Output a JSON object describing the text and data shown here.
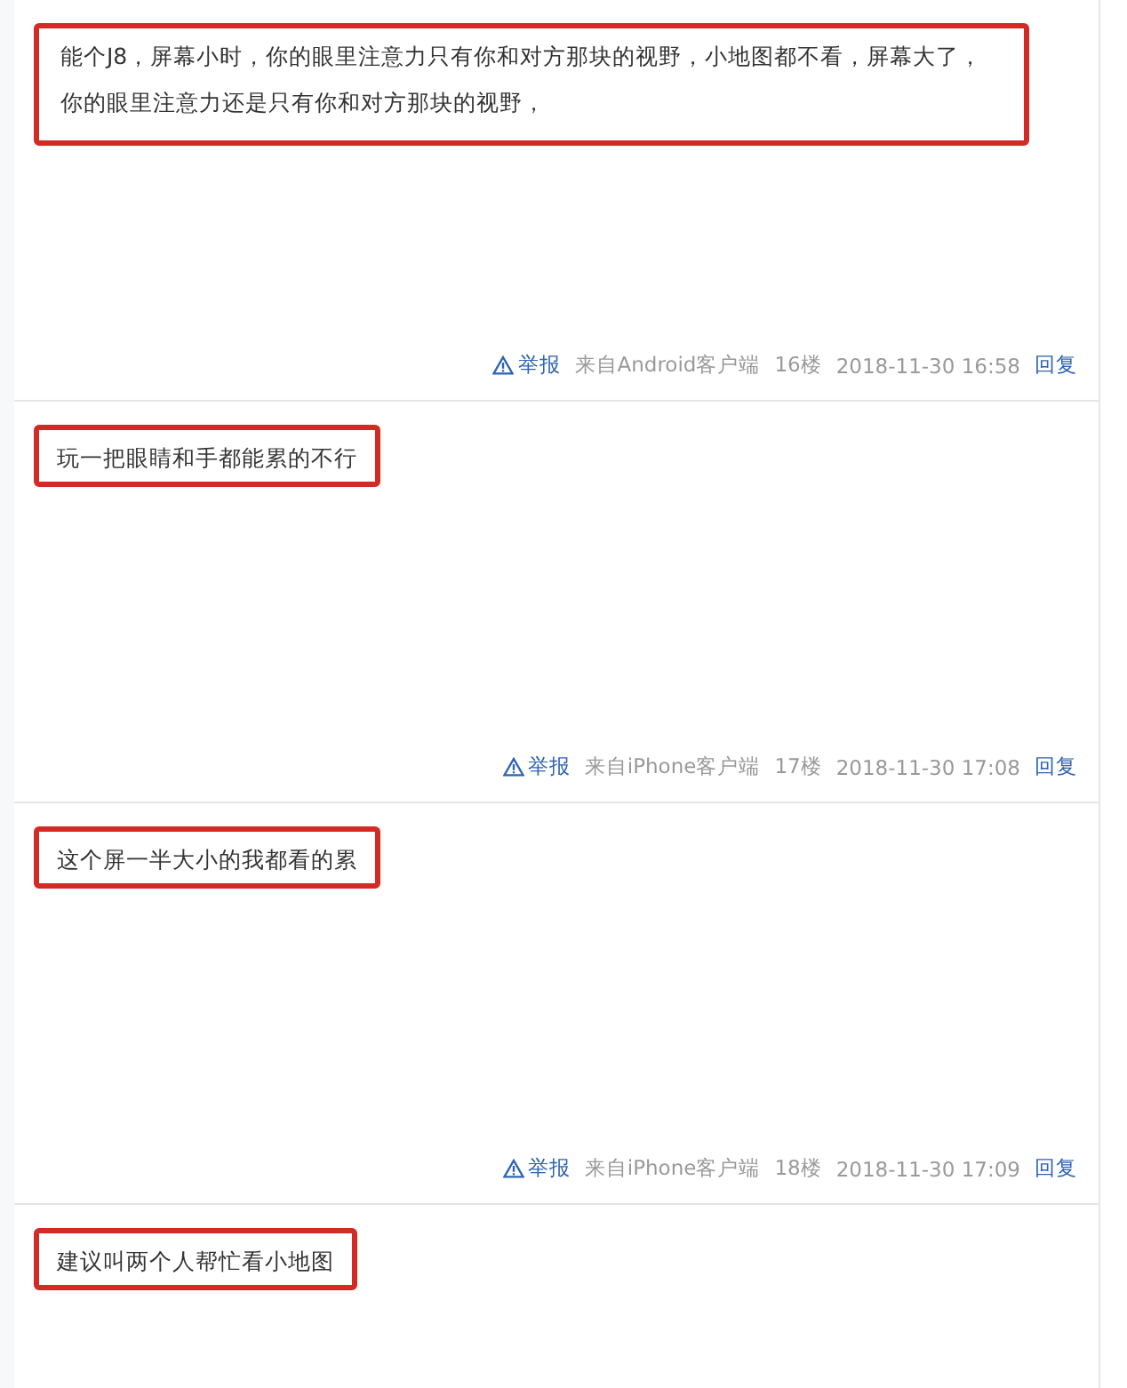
{
  "replies": [
    {
      "text": "能个J8，屏幕小时，你的眼里注意力只有你和对方那块的视野，小地图都不看，屏幕大了，你的眼里注意力还是只有你和对方那块的视野，",
      "report": "举报",
      "source": "来自Android客户端",
      "floor": "16楼",
      "time": "2018-11-30 16:58",
      "reply": "回复"
    },
    {
      "text": "玩一把眼睛和手都能累的不行",
      "report": "举报",
      "source": "来自iPhone客户端",
      "floor": "17楼",
      "time": "2018-11-30 17:08",
      "reply": "回复"
    },
    {
      "text": "这个屏一半大小的我都看的累",
      "report": "举报",
      "source": "来自iPhone客户端",
      "floor": "18楼",
      "time": "2018-11-30 17:09",
      "reply": "回复"
    },
    {
      "text": "建议叫两个人帮忙看小地图"
    }
  ]
}
